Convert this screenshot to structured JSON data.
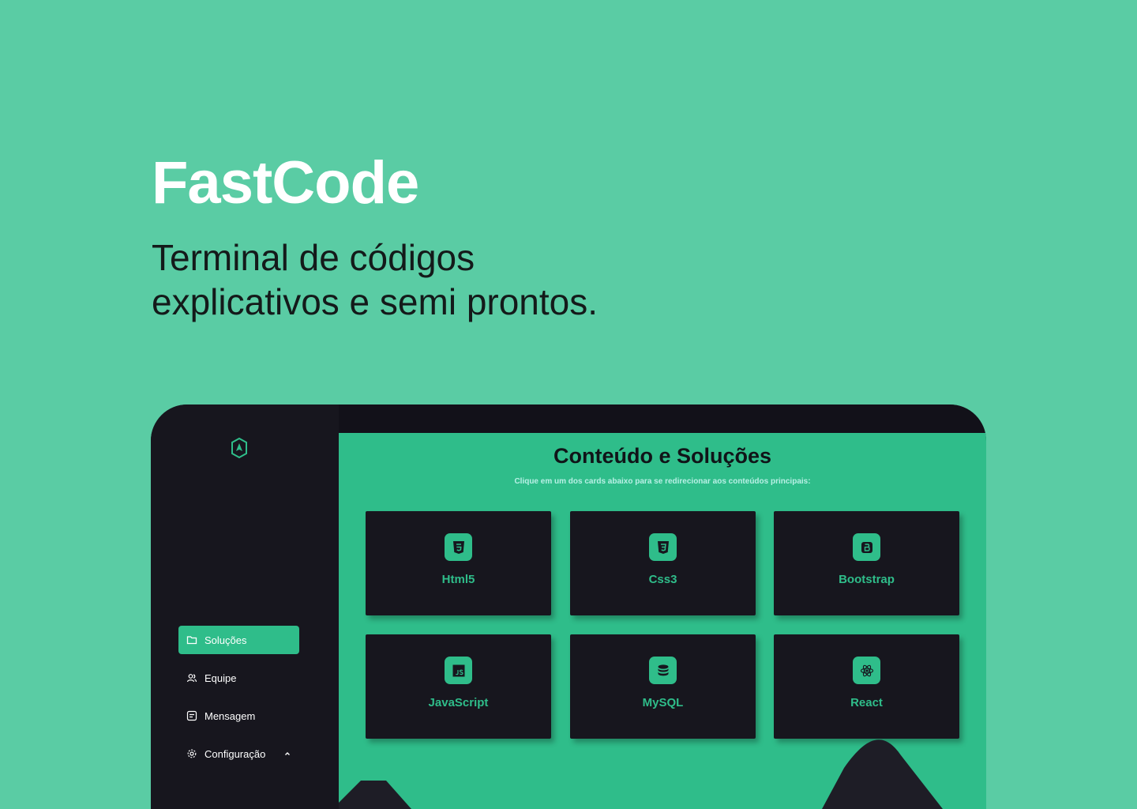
{
  "hero": {
    "title": "FastCode",
    "subtitle_line1": "Terminal de códigos",
    "subtitle_line2": "explicativos e semi prontos."
  },
  "sidebar": {
    "items": [
      {
        "label": "Soluções",
        "icon": "folder-icon",
        "active": true
      },
      {
        "label": "Equipe",
        "icon": "users-icon",
        "active": false
      },
      {
        "label": "Mensagem",
        "icon": "message-icon",
        "active": false
      },
      {
        "label": "Configuração",
        "icon": "gear-icon",
        "active": false
      }
    ]
  },
  "main": {
    "title": "Conteúdo e Soluções",
    "subtitle": "Clique em um dos cards abaixo para se redirecionar aos conteúdos principais:",
    "cards": [
      {
        "label": "Html5",
        "icon": "html5-icon"
      },
      {
        "label": "Css3",
        "icon": "css3-icon"
      },
      {
        "label": "Bootstrap",
        "icon": "bootstrap-icon"
      },
      {
        "label": "JavaScript",
        "icon": "javascript-icon"
      },
      {
        "label": "MySQL",
        "icon": "database-icon"
      },
      {
        "label": "React",
        "icon": "react-icon"
      }
    ]
  },
  "colors": {
    "background": "#5acca4",
    "accent": "#2fbd8a",
    "panel": "#17161e",
    "hero_title": "#ffffff",
    "hero_subtitle": "#141a1a"
  }
}
